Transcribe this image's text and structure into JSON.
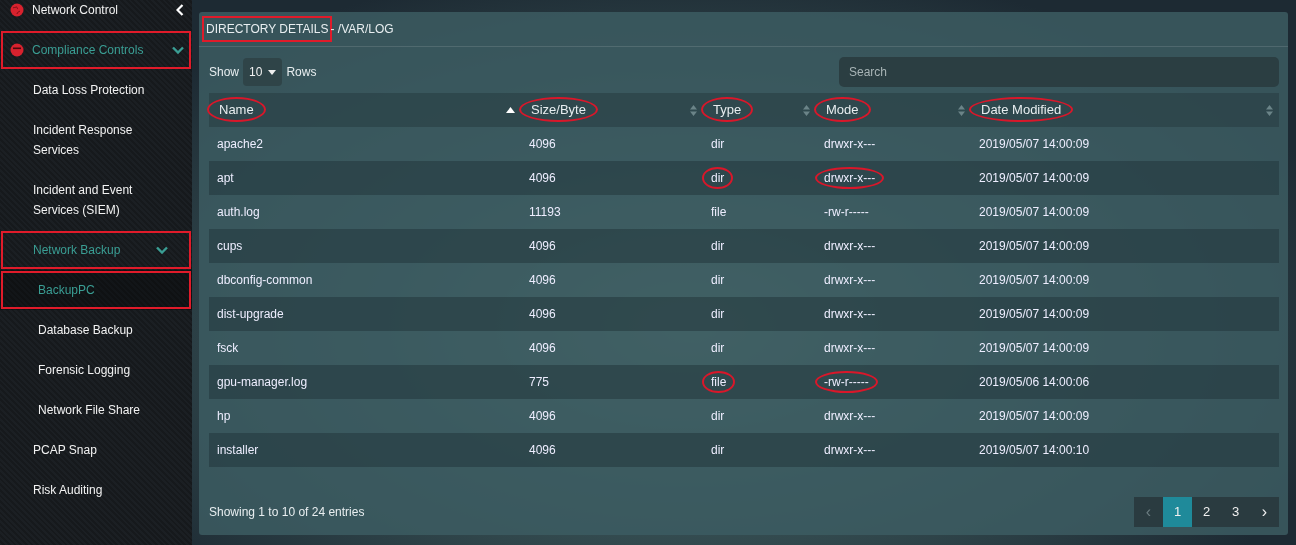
{
  "sidebar": {
    "items": [
      {
        "label": "Network Control",
        "expanded": false,
        "selected": false
      },
      {
        "label": "Compliance Controls",
        "expanded": true,
        "boxed": true,
        "children": [
          {
            "label": "Data Loss Protection",
            "selected": false
          },
          {
            "label": "Incident Response Services",
            "selected": false
          },
          {
            "label": "Incident and Event Services (SIEM)",
            "selected": false
          },
          {
            "label": "Network Backup",
            "expanded": true,
            "boxed": true,
            "children": [
              {
                "label": "BackupPC",
                "selected": true,
                "boxed": true
              },
              {
                "label": "Database Backup",
                "selected": false
              },
              {
                "label": "Forensic Logging",
                "selected": false
              },
              {
                "label": "Network File Share",
                "selected": false
              }
            ]
          },
          {
            "label": "PCAP Snap",
            "selected": false
          },
          {
            "label": "Risk Auditing",
            "selected": false
          }
        ]
      }
    ]
  },
  "panel": {
    "title": "DIRECTORY DETAILS",
    "title_boxed": true,
    "path": " - /VAR/LOG",
    "length": {
      "before": "Show",
      "value": "10",
      "after": "Rows"
    },
    "search": {
      "placeholder": "Search"
    },
    "table": {
      "columns": [
        {
          "label": "Name",
          "sorted": true,
          "circled": true
        },
        {
          "label": "Size/Byte",
          "sorted": false,
          "circled": true
        },
        {
          "label": "Type",
          "sorted": false,
          "circled": true
        },
        {
          "label": "Mode",
          "sorted": false,
          "circled": true
        },
        {
          "label": "Date Modified",
          "sorted": false,
          "circled": true
        }
      ],
      "rows": [
        {
          "cells": [
            "apache2",
            "4096",
            "dir",
            "drwxr-x---",
            "2019/05/07 14:00:09"
          ]
        },
        {
          "cells": [
            "apt",
            "4096",
            "dir",
            "drwxr-x---",
            "2019/05/07 14:00:09"
          ],
          "type_and_mode_circled": true
        },
        {
          "cells": [
            "auth.log",
            "11193",
            "file",
            "-rw-r-----",
            "2019/05/07 14:00:09"
          ]
        },
        {
          "cells": [
            "cups",
            "4096",
            "dir",
            "drwxr-x---",
            "2019/05/07 14:00:09"
          ]
        },
        {
          "cells": [
            "dbconfig-common",
            "4096",
            "dir",
            "drwxr-x---",
            "2019/05/07 14:00:09"
          ]
        },
        {
          "cells": [
            "dist-upgrade",
            "4096",
            "dir",
            "drwxr-x---",
            "2019/05/07 14:00:09"
          ]
        },
        {
          "cells": [
            "fsck",
            "4096",
            "dir",
            "drwxr-x---",
            "2019/05/07 14:00:09"
          ]
        },
        {
          "cells": [
            "gpu-manager.log",
            "775",
            "file",
            "-rw-r-----",
            "2019/05/06 14:00:06"
          ],
          "type_and_mode_circled": true
        },
        {
          "cells": [
            "hp",
            "4096",
            "dir",
            "drwxr-x---",
            "2019/05/07 14:00:09"
          ]
        },
        {
          "cells": [
            "installer",
            "4096",
            "dir",
            "drwxr-x---",
            "2019/05/07 14:00:10"
          ]
        }
      ]
    },
    "info": "Showing 1 to 10 of 24 entries",
    "pagination": [
      {
        "label": "‹",
        "kind": "prev",
        "disabled": true,
        "selected": false
      },
      {
        "label": "1",
        "kind": "page",
        "disabled": false,
        "selected": true
      },
      {
        "label": "2",
        "kind": "page",
        "disabled": false,
        "selected": false
      },
      {
        "label": "3",
        "kind": "page",
        "disabled": false,
        "selected": false
      },
      {
        "label": "›",
        "kind": "next",
        "disabled": false,
        "selected": false
      }
    ]
  }
}
